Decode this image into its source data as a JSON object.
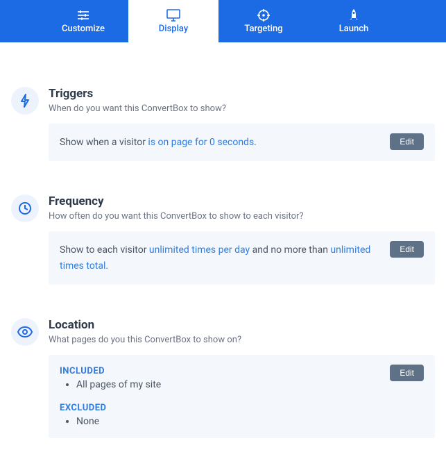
{
  "tabs": {
    "customize": "Customize",
    "display": "Display",
    "targeting": "Targeting",
    "launch": "Launch"
  },
  "triggers": {
    "title": "Triggers",
    "subtitle": "When do you want this ConvertBox to show?",
    "text_prefix": "Show when a visitor ",
    "text_highlight": "is on page for 0 seconds",
    "text_suffix": ".",
    "edit": "Edit"
  },
  "frequency": {
    "title": "Frequency",
    "subtitle": "How often do you want this ConvertBox to show to each visitor?",
    "text_prefix": "Show to each visitor ",
    "text_highlight1": "unlimited times per day",
    "text_mid": " and no more than ",
    "text_highlight2": "unlimited times total",
    "text_suffix": ".",
    "edit": "Edit"
  },
  "location": {
    "title": "Location",
    "subtitle": "What pages do you this ConvertBox to show on?",
    "included_label": "INCLUDED",
    "included_item": "All pages of my site",
    "excluded_label": "EXCLUDED",
    "excluded_item": "None",
    "edit": "Edit"
  }
}
